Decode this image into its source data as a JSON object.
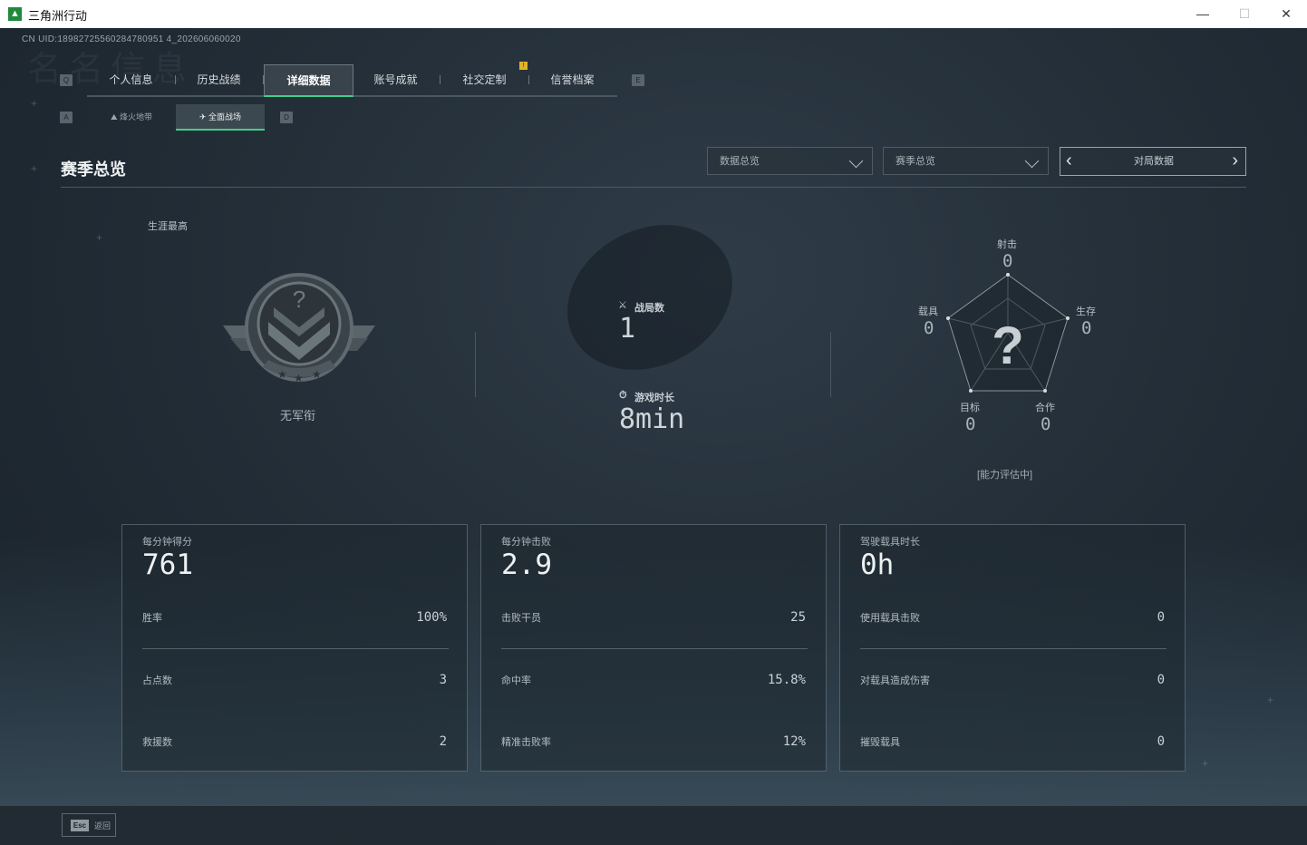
{
  "window": {
    "title": "三角洲行动",
    "icon": "delta-logo-icon",
    "min": "—",
    "max": "☐",
    "close": "✕"
  },
  "uid": "CN UID:18982725560284780951 4_202606060020",
  "ghost_title": "名名信息",
  "keys": {
    "q": "Q",
    "e": "E",
    "a": "A",
    "d": "D"
  },
  "tabs": [
    {
      "label": "个人信息"
    },
    {
      "label": "历史战绩"
    },
    {
      "label": "详细数据",
      "active": true
    },
    {
      "label": "账号成就"
    },
    {
      "label": "社交定制"
    },
    {
      "label": "信誉档案"
    }
  ],
  "notify_badge": "!",
  "subtabs": [
    {
      "label": "烽火地带",
      "icon": "fire-zone-icon"
    },
    {
      "label": "全面战场",
      "icon": "battlefield-icon",
      "active": true
    }
  ],
  "section": {
    "title": "赛季总览"
  },
  "dropdowns": [
    {
      "label": "数据总览"
    },
    {
      "label": "赛季总览"
    }
  ],
  "pager": {
    "label": "对局数据",
    "prev": "‹",
    "next": "›"
  },
  "rank": {
    "label": "生涯最高",
    "name": "无军衔",
    "badge_glyph": "?"
  },
  "match": {
    "battles_label": "战局数",
    "battles_value": "1",
    "time_label": "游戏时长",
    "time_value": "8min"
  },
  "radar": {
    "center": "?",
    "axes": [
      {
        "label": "射击",
        "value": "0"
      },
      {
        "label": "生存",
        "value": "0"
      },
      {
        "label": "合作",
        "value": "0"
      },
      {
        "label": "目标",
        "value": "0"
      },
      {
        "label": "载具",
        "value": "0"
      }
    ],
    "status": "[能力评估中]"
  },
  "cards": [
    {
      "title": "每分钟得分",
      "value": "761",
      "rows": [
        {
          "label": "胜率",
          "value": "100%"
        },
        {
          "label": "占点数",
          "value": "3"
        },
        {
          "label": "救援数",
          "value": "2"
        }
      ]
    },
    {
      "title": "每分钟击败",
      "value": "2.9",
      "rows": [
        {
          "label": "击败干员",
          "value": "25"
        },
        {
          "label": "命中率",
          "value": "15.8%"
        },
        {
          "label": "精准击败率",
          "value": "12%"
        }
      ]
    },
    {
      "title": "驾驶载具时长",
      "value": "0h",
      "rows": [
        {
          "label": "使用载具击败",
          "value": "0"
        },
        {
          "label": "对载具造成伤害",
          "value": "0"
        },
        {
          "label": "摧毁载具",
          "value": "0"
        }
      ]
    }
  ],
  "footer": {
    "esc_key": "Esc",
    "esc_label": "返回"
  }
}
